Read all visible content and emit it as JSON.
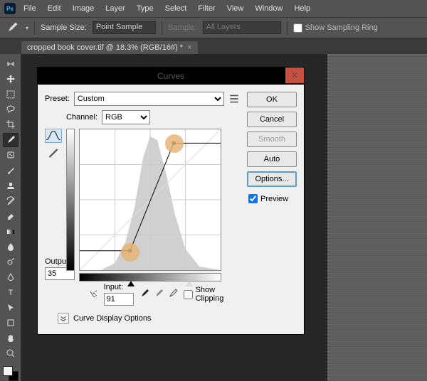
{
  "menubar": [
    "File",
    "Edit",
    "Image",
    "Layer",
    "Type",
    "Select",
    "Filter",
    "View",
    "Window",
    "Help"
  ],
  "optionsbar": {
    "sample_size_label": "Sample Size:",
    "sample_size_value": "Point Sample",
    "sample_label": "Sample:",
    "sample_value": "All Layers",
    "show_ring_label": "Show Sampling Ring",
    "show_ring_checked": false
  },
  "tab": {
    "label": "cropped book cover.tif @ 18.3% (RGB/16#) *"
  },
  "dialog": {
    "title": "Curves",
    "preset_label": "Preset:",
    "preset_value": "Custom",
    "channel_label": "Channel:",
    "channel_value": "RGB",
    "output_label": "Output:",
    "output_value": "35",
    "input_label": "Input:",
    "input_value": "91",
    "show_clipping_label": "Show Clipping",
    "show_clipping_checked": false,
    "curve_display_label": "Curve Display Options",
    "buttons": {
      "ok": "OK",
      "cancel": "Cancel",
      "smooth": "Smooth",
      "auto": "Auto",
      "options": "Options..."
    },
    "preview_label": "Preview",
    "preview_checked": true
  },
  "chart_data": {
    "type": "line",
    "title": "Curves",
    "xlabel": "Input",
    "ylabel": "Output",
    "xlim": [
      0,
      255
    ],
    "ylim": [
      0,
      255
    ],
    "control_points": [
      {
        "input": 0,
        "output": 35
      },
      {
        "input": 91,
        "output": 35
      },
      {
        "input": 170,
        "output": 230
      },
      {
        "input": 255,
        "output": 230
      }
    ],
    "histogram_peak_input": 110,
    "black_slider": 91,
    "white_slider": 190
  }
}
